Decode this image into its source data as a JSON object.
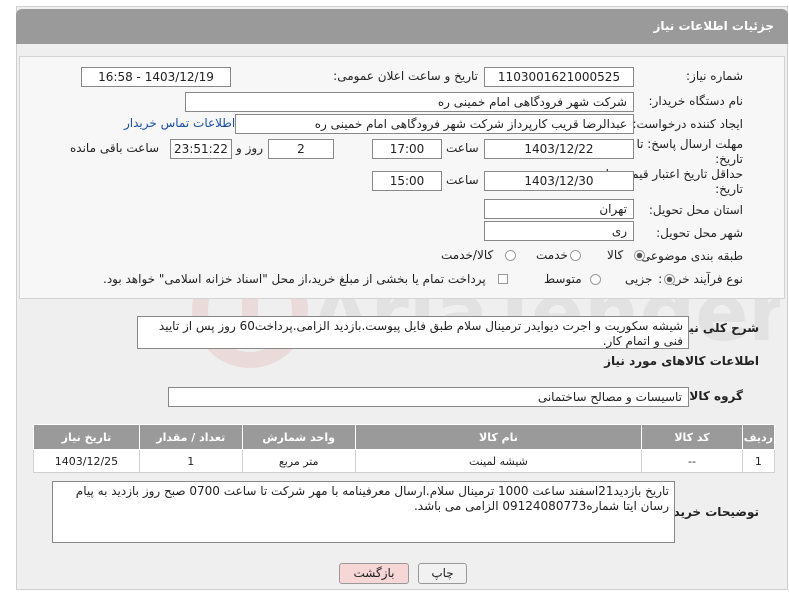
{
  "header": {
    "title": "جزئیات اطلاعات نیاز"
  },
  "form": {
    "need_number_label": "شماره نیاز:",
    "need_number": "1103001621000525",
    "announce_label": "تاریخ و ساعت اعلان عمومی:",
    "announce_value": "1403/12/19 - 16:58",
    "buyer_org_label": "نام دستگاه خریدار:",
    "buyer_org": "شرکت شهر فرودگاهی امام خمینی  ره",
    "creator_label": "ایجاد کننده درخواست:",
    "creator": "عبدالرضا قریب کارپرداز شرکت شهر فرودگاهی امام خمینی  ره",
    "buyer_contact_link": "اطلاعات تماس خریدار",
    "deadline_label": "مهلت ارسال پاسخ: تا تاریخ:",
    "deadline_date": "1403/12/22",
    "time_label": "ساعت",
    "deadline_time": "17:00",
    "days_value": "2",
    "days_label": "روز و",
    "remaining_time": "23:51:22",
    "remaining_label": "ساعت باقی مانده",
    "validity_label": "حداقل تاریخ اعتبار قیمت: تا تاریخ:",
    "validity_date": "1403/12/30",
    "validity_time": "15:00",
    "province_label": "استان محل تحویل:",
    "province": "تهران",
    "city_label": "شهر محل تحویل:",
    "city": "ری",
    "category_label": "طبقه بندی موضوعی:",
    "category_options": [
      "کالا",
      "خدمت",
      "کالا/خدمت"
    ],
    "category_selected": "کالا",
    "process_label": "نوع فرآیند خرید :",
    "process_options": [
      "جزیی",
      "متوسط"
    ],
    "process_selected": "جزیی",
    "payment_note": "پرداخت تمام یا بخشی از مبلغ خرید،از محل \"اسناد خزانه اسلامی\" خواهد بود."
  },
  "description": {
    "label": "شرح کلی نیاز:",
    "text": "شیشه سکوریت و اجرت دیوایدر ترمینال سلام طبق فایل پیوست.بازدید الزامی.پرداخت60 روز پس از تایید فنی و اتمام کار."
  },
  "goods": {
    "section_title": "اطلاعات کالاهای مورد نیاز",
    "group_label": "گروه کالا:",
    "group_value": "تاسیسات و مصالح ساختمانی",
    "columns": [
      "ردیف",
      "کد کالا",
      "نام کالا",
      "واحد شمارش",
      "تعداد / مقدار",
      "تاریخ نیاز"
    ],
    "rows": [
      [
        "1",
        "--",
        "شیشه لمینت",
        "متر مربع",
        "1",
        "1403/12/25"
      ]
    ]
  },
  "buyer_notes": {
    "label": "توضیحات خریدار:",
    "text": "تاریخ بازدید21اسفند ساعت 1000 ترمینال سلام.ارسال معرفینامه با مهر شرکت تا ساعت 0700 صبح روز بازدید به پیام رسان ایتا شماره09124080773 الزامی می باشد."
  },
  "buttons": {
    "print": "چاپ",
    "back": "بازگشت"
  },
  "watermark": {
    "text": "AriaTender.neT"
  },
  "colors": {
    "title_bar": "#9a9a9a",
    "link": "#1a4fa3",
    "back_button": "#f7d6d6",
    "watermark": "#c0392b"
  }
}
